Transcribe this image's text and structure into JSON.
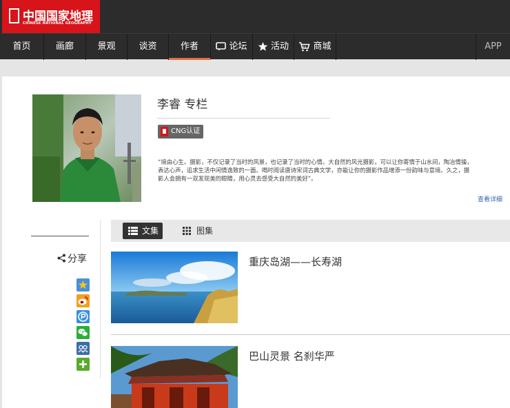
{
  "header": {
    "logo_cn": "中国国家地理",
    "logo_en": "CHINESE NATIONAL GEOGRAPHY",
    "brand_color": "#d7141a"
  },
  "nav": {
    "items": [
      {
        "label": "首页",
        "icon": ""
      },
      {
        "label": "画廊",
        "icon": ""
      },
      {
        "label": "景观",
        "icon": ""
      },
      {
        "label": "谈资",
        "icon": ""
      },
      {
        "label": "作者",
        "icon": "",
        "active": true
      },
      {
        "label": "论坛",
        "icon": "chat-icon"
      },
      {
        "label": "活动",
        "icon": "star-icon"
      },
      {
        "label": "商城",
        "icon": "cart-icon"
      }
    ],
    "app_label": "APP",
    "active_color": "#e07040"
  },
  "profile": {
    "title": "李睿  专栏",
    "badge": "CNG认证",
    "quote": "“境由心生。摄影，不仅记录了当时的风景，也记录了当时的心情。大自然的风光摄影，可以让你寄情于山水间，陶冶情操，表达心声，追求生活中闲情逸致的一面。喝时阅读唐诗宋词古典文学，亦能让你的摄影作品增添一份韵味与意境。久之，摄影人会拥有一双发现美的眼睛，用心灵去感受大自然的美好”。",
    "more_link": "查看详细"
  },
  "share": {
    "label": "分享",
    "icons": [
      {
        "name": "favorite-star-icon",
        "color": "#4a90d9"
      },
      {
        "name": "weibo-icon",
        "color": "#f0a020"
      },
      {
        "name": "pengyou-icon",
        "color": "#3a8ed8"
      },
      {
        "name": "wechat-icon",
        "color": "#2aae3a"
      },
      {
        "name": "renren-icon",
        "color": "#3b6ea8"
      },
      {
        "name": "more-plus-icon",
        "color": "#5aaa2e"
      }
    ]
  },
  "tabs": {
    "active": "文集",
    "inactive": "图集"
  },
  "articles": [
    {
      "title": "重庆岛湖——长寿湖"
    },
    {
      "title": "巴山灵景 名刹华严"
    }
  ]
}
